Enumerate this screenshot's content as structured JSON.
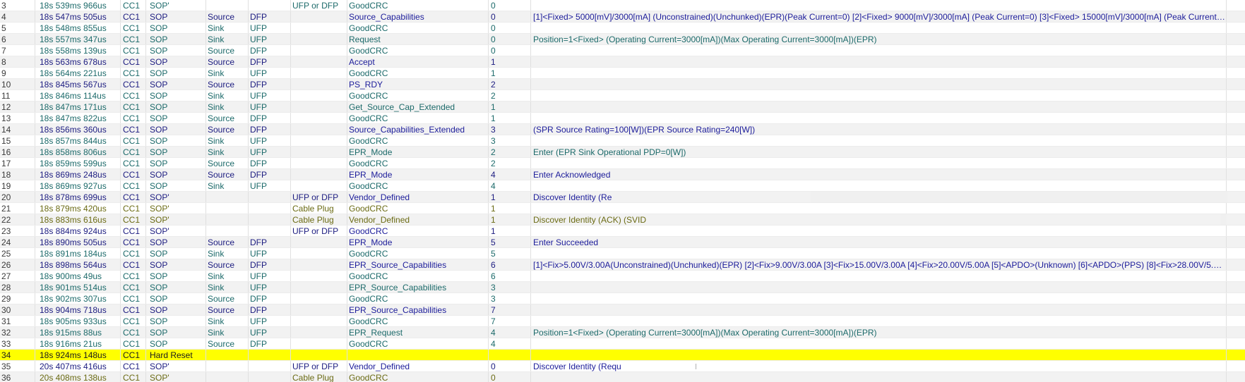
{
  "rows": [
    {
      "idx": "3",
      "time": "18s 539ms 966us",
      "cc": "CC1",
      "sop": "SOP'",
      "role": "",
      "dir": "",
      "cable": "UFP or DFP",
      "msg": "GoodCRC",
      "id": "0",
      "detail": "",
      "kind": "good"
    },
    {
      "idx": "4",
      "time": "18s 547ms 505us",
      "cc": "CC1",
      "sop": "SOP",
      "role": "Source",
      "dir": "DFP",
      "cable": "",
      "msg": "Source_Capabilities",
      "id": "0",
      "detail": "[1]<Fixed> 5000[mV]/3000[mA] (Unconstrained)(Unchunked)(EPR)(Peak Current=0) [2]<Fixed> 9000[mV]/3000[mA] (Peak Current=0) [3]<Fixed> 15000[mV]/3000[mA] (Peak Current=...",
      "kind": "sop"
    },
    {
      "idx": "5",
      "time": "18s 548ms 855us",
      "cc": "CC1",
      "sop": "SOP",
      "role": "Sink",
      "dir": "UFP",
      "cable": "",
      "msg": "GoodCRC",
      "id": "0",
      "detail": "",
      "kind": "good"
    },
    {
      "idx": "6",
      "time": "18s 557ms 347us",
      "cc": "CC1",
      "sop": "SOP",
      "role": "Sink",
      "dir": "UFP",
      "cable": "",
      "msg": "Request",
      "id": "0",
      "detail": "Position=1<Fixed> (Operating Current=3000[mA])(Max Operating Current=3000[mA])(EPR)",
      "kind": "good"
    },
    {
      "idx": "7",
      "time": "18s 558ms 139us",
      "cc": "CC1",
      "sop": "SOP",
      "role": "Source",
      "dir": "DFP",
      "cable": "",
      "msg": "GoodCRC",
      "id": "0",
      "detail": "",
      "kind": "good"
    },
    {
      "idx": "8",
      "time": "18s 563ms 678us",
      "cc": "CC1",
      "sop": "SOP",
      "role": "Source",
      "dir": "DFP",
      "cable": "",
      "msg": "Accept",
      "id": "1",
      "detail": "",
      "kind": "sop"
    },
    {
      "idx": "9",
      "time": "18s 564ms 221us",
      "cc": "CC1",
      "sop": "SOP",
      "role": "Sink",
      "dir": "UFP",
      "cable": "",
      "msg": "GoodCRC",
      "id": "1",
      "detail": "",
      "kind": "good"
    },
    {
      "idx": "10",
      "time": "18s 845ms 567us",
      "cc": "CC1",
      "sop": "SOP",
      "role": "Source",
      "dir": "DFP",
      "cable": "",
      "msg": "PS_RDY",
      "id": "2",
      "detail": "",
      "kind": "sop"
    },
    {
      "idx": "11",
      "time": "18s 846ms 114us",
      "cc": "CC1",
      "sop": "SOP",
      "role": "Sink",
      "dir": "UFP",
      "cable": "",
      "msg": "GoodCRC",
      "id": "2",
      "detail": "",
      "kind": "good"
    },
    {
      "idx": "12",
      "time": "18s 847ms 171us",
      "cc": "CC1",
      "sop": "SOP",
      "role": "Sink",
      "dir": "UFP",
      "cable": "",
      "msg": "Get_Source_Cap_Extended",
      "id": "1",
      "detail": "",
      "kind": "good"
    },
    {
      "idx": "13",
      "time": "18s 847ms 822us",
      "cc": "CC1",
      "sop": "SOP",
      "role": "Source",
      "dir": "DFP",
      "cable": "",
      "msg": "GoodCRC",
      "id": "1",
      "detail": "",
      "kind": "good"
    },
    {
      "idx": "14",
      "time": "18s 856ms 360us",
      "cc": "CC1",
      "sop": "SOP",
      "role": "Source",
      "dir": "DFP",
      "cable": "",
      "msg": "Source_Capabilities_Extended",
      "id": "3",
      "detail": "(SPR Source Rating=100[W])(EPR Source Rating=240[W])",
      "kind": "sop"
    },
    {
      "idx": "15",
      "time": "18s 857ms 844us",
      "cc": "CC1",
      "sop": "SOP",
      "role": "Sink",
      "dir": "UFP",
      "cable": "",
      "msg": "GoodCRC",
      "id": "3",
      "detail": "",
      "kind": "good"
    },
    {
      "idx": "16",
      "time": "18s 858ms 806us",
      "cc": "CC1",
      "sop": "SOP",
      "role": "Sink",
      "dir": "UFP",
      "cable": "",
      "msg": "EPR_Mode",
      "id": "2",
      "detail": "Enter (EPR Sink Operational PDP=0[W])",
      "kind": "good"
    },
    {
      "idx": "17",
      "time": "18s 859ms 599us",
      "cc": "CC1",
      "sop": "SOP",
      "role": "Source",
      "dir": "DFP",
      "cable": "",
      "msg": "GoodCRC",
      "id": "2",
      "detail": "",
      "kind": "good"
    },
    {
      "idx": "18",
      "time": "18s 869ms 248us",
      "cc": "CC1",
      "sop": "SOP",
      "role": "Source",
      "dir": "DFP",
      "cable": "",
      "msg": "EPR_Mode",
      "id": "4",
      "detail": "Enter Acknowledged",
      "kind": "sop"
    },
    {
      "idx": "19",
      "time": "18s 869ms 927us",
      "cc": "CC1",
      "sop": "SOP",
      "role": "Sink",
      "dir": "UFP",
      "cable": "",
      "msg": "GoodCRC",
      "id": "4",
      "detail": "",
      "kind": "good"
    },
    {
      "idx": "20",
      "time": "18s 878ms 699us",
      "cc": "CC1",
      "sop": "SOP'",
      "role": "",
      "dir": "",
      "cable": "UFP or DFP",
      "msg": "Vendor_Defined",
      "id": "1",
      "detail": "Discover Identity (Re",
      "kind": "sop"
    },
    {
      "idx": "21",
      "time": "18s 879ms 420us",
      "cc": "CC1",
      "sop": "SOP'",
      "role": "",
      "dir": "",
      "cable": "Cable Plug",
      "msg": "GoodCRC",
      "id": "1",
      "detail": "",
      "kind": "cable"
    },
    {
      "idx": "22",
      "time": "18s 883ms 616us",
      "cc": "CC1",
      "sop": "SOP'",
      "role": "",
      "dir": "",
      "cable": "Cable Plug",
      "msg": "Vendor_Defined",
      "id": "1",
      "detail": "Discover Identity (ACK) (SVID",
      "kind": "cable"
    },
    {
      "idx": "23",
      "time": "18s 884ms 924us",
      "cc": "CC1",
      "sop": "SOP'",
      "role": "",
      "dir": "",
      "cable": "UFP or DFP",
      "msg": "GoodCRC",
      "id": "1",
      "detail": "",
      "kind": "sop"
    },
    {
      "idx": "24",
      "time": "18s 890ms 505us",
      "cc": "CC1",
      "sop": "SOP",
      "role": "Source",
      "dir": "DFP",
      "cable": "",
      "msg": "EPR_Mode",
      "id": "5",
      "detail": "Enter Succeeded",
      "kind": "sop"
    },
    {
      "idx": "25",
      "time": "18s 891ms 184us",
      "cc": "CC1",
      "sop": "SOP",
      "role": "Sink",
      "dir": "UFP",
      "cable": "",
      "msg": "GoodCRC",
      "id": "5",
      "detail": "",
      "kind": "good"
    },
    {
      "idx": "26",
      "time": "18s 898ms 564us",
      "cc": "CC1",
      "sop": "SOP",
      "role": "Source",
      "dir": "DFP",
      "cable": "",
      "msg": "EPR_Source_Capabilities",
      "id": "6",
      "detail": "[1]<Fix>5.00V/3.00A(Unconstrained)(Unchunked)(EPR) [2]<Fix>9.00V/3.00A [3]<Fix>15.00V/3.00A [4]<Fix>20.00V/5.00A [5]<APDO>(Unknown) [6]<APDO>(PPS) [8]<Fix>28.00V/5.00A ...",
      "kind": "sop"
    },
    {
      "idx": "27",
      "time": "18s 900ms  49us",
      "cc": "CC1",
      "sop": "SOP",
      "role": "Sink",
      "dir": "UFP",
      "cable": "",
      "msg": "GoodCRC",
      "id": "6",
      "detail": "",
      "kind": "good"
    },
    {
      "idx": "28",
      "time": "18s 901ms 514us",
      "cc": "CC1",
      "sop": "SOP",
      "role": "Sink",
      "dir": "UFP",
      "cable": "",
      "msg": "EPR_Source_Capabilities",
      "id": "3",
      "detail": "",
      "kind": "good"
    },
    {
      "idx": "29",
      "time": "18s 902ms 307us",
      "cc": "CC1",
      "sop": "SOP",
      "role": "Source",
      "dir": "DFP",
      "cable": "",
      "msg": "GoodCRC",
      "id": "3",
      "detail": "",
      "kind": "good"
    },
    {
      "idx": "30",
      "time": "18s 904ms 718us",
      "cc": "CC1",
      "sop": "SOP",
      "role": "Source",
      "dir": "DFP",
      "cable": "",
      "msg": "EPR_Source_Capabilities",
      "id": "7",
      "detail": "",
      "kind": "sop"
    },
    {
      "idx": "31",
      "time": "18s 905ms 933us",
      "cc": "CC1",
      "sop": "SOP",
      "role": "Sink",
      "dir": "UFP",
      "cable": "",
      "msg": "GoodCRC",
      "id": "7",
      "detail": "",
      "kind": "good"
    },
    {
      "idx": "32",
      "time": "18s 915ms  88us",
      "cc": "CC1",
      "sop": "SOP",
      "role": "Sink",
      "dir": "UFP",
      "cable": "",
      "msg": "EPR_Request",
      "id": "4",
      "detail": "Position=1<Fixed> (Operating Current=3000[mA])(Max Operating Current=3000[mA])(EPR)",
      "kind": "good"
    },
    {
      "idx": "33",
      "time": "18s 916ms  21us",
      "cc": "CC1",
      "sop": "SOP",
      "role": "Source",
      "dir": "DFP",
      "cable": "",
      "msg": "GoodCRC",
      "id": "4",
      "detail": "",
      "kind": "good"
    },
    {
      "idx": "34",
      "time": "18s 924ms 148us",
      "cc": "CC1",
      "sop": "Hard Reset",
      "role": "",
      "dir": "",
      "cable": "",
      "msg": "",
      "id": "",
      "detail": "",
      "kind": "reset"
    },
    {
      "idx": "35",
      "time": "20s 407ms 416us",
      "cc": "CC1",
      "sop": "SOP'",
      "role": "",
      "dir": "",
      "cable": "UFP or DFP",
      "msg": "Vendor_Defined",
      "id": "0",
      "detail": "Discover Identity (Requ",
      "kind": "sop"
    },
    {
      "idx": "36",
      "time": "20s 408ms 138us",
      "cc": "CC1",
      "sop": "SOP'",
      "role": "",
      "dir": "",
      "cable": "Cable Plug",
      "msg": "GoodCRC",
      "id": "0",
      "detail": "",
      "kind": "cable"
    }
  ],
  "colors": {
    "highlight": "#ffff00",
    "sop_text": "#1c1c80",
    "goodcrc_text": "#1c6a6a",
    "cable_text": "#6b6b14",
    "alt_row": "#f2f2f2"
  }
}
